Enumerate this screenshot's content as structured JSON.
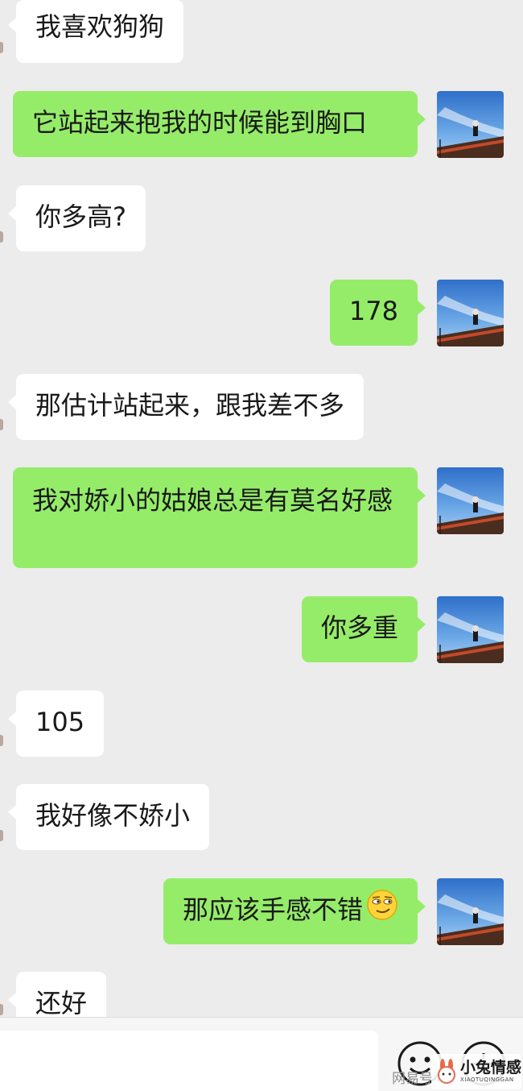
{
  "colors": {
    "background": "#ececec",
    "incoming_bubble": "#ffffff",
    "outgoing_bubble": "#95ec69",
    "text": "#191919"
  },
  "messages": [
    {
      "sender": "other",
      "text": "我喜欢狗狗"
    },
    {
      "sender": "me",
      "text": "它站起来抱我的时候能到胸口",
      "avatar": "sky-photo-avatar"
    },
    {
      "sender": "other",
      "text": "你多高?"
    },
    {
      "sender": "me",
      "text": "178",
      "avatar": "sky-photo-avatar"
    },
    {
      "sender": "other",
      "text": "那估计站起来，跟我差不多"
    },
    {
      "sender": "me",
      "text": "我对娇小的姑娘总是有莫名好感",
      "avatar": "sky-photo-avatar"
    },
    {
      "sender": "me",
      "text": "你多重",
      "avatar": "sky-photo-avatar"
    },
    {
      "sender": "other",
      "text": "105"
    },
    {
      "sender": "other",
      "text": "我好像不娇小"
    },
    {
      "sender": "me",
      "text": "那应该手感不错",
      "emoji": "smirk-emoji",
      "avatar": "sky-photo-avatar"
    },
    {
      "sender": "other",
      "text": "还好"
    }
  ],
  "input_bar": {
    "left_icon": "emoji-face-icon",
    "right_icon": "add-more-icon"
  },
  "watermarks": {
    "left_text": "网易号",
    "brand_name": "小兔情感",
    "brand_sub": "XIAOTUQINGGAN",
    "brand_icon": "rabbit-logo-icon"
  }
}
